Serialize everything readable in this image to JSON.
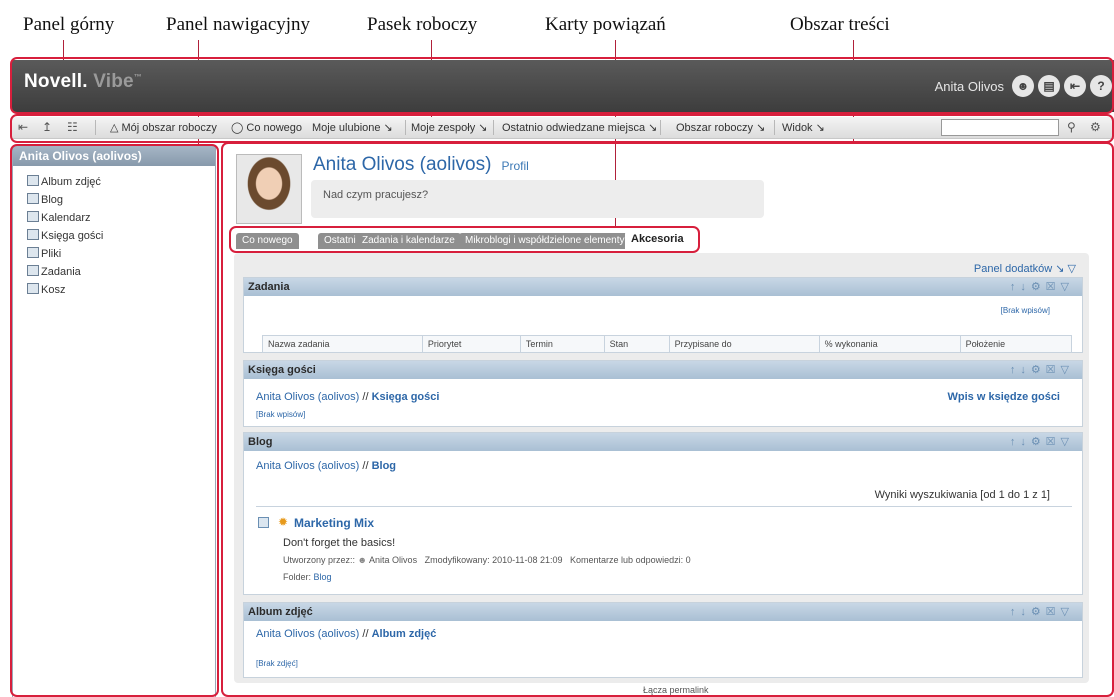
{
  "callouts": {
    "top_panel": "Panel górny",
    "nav_panel": "Panel nawigacyjny",
    "workspace_bar": "Pasek roboczy",
    "tabs": "Karty powiązań",
    "content_area": "Obszar treści"
  },
  "header": {
    "logo_main": "Novell.",
    "logo_vibe": "Vibe",
    "logo_tm": "™",
    "user": "Anita Olivos",
    "icons": [
      "person-icon",
      "notes-icon",
      "logout-icon",
      "help-icon"
    ]
  },
  "toolbar": {
    "my_workspace": "Mój obszar roboczy",
    "whats_new": "Co nowego",
    "favorites": "Moje ulubione",
    "teams": "Moje zespoły",
    "recent": "Ostatnio odwiedzane miejsca",
    "workspace": "Obszar roboczy",
    "view": "Widok",
    "search_value": ""
  },
  "sidebar": {
    "title": "Anita Olivos (aolivos)",
    "items": [
      {
        "label": "Album zdjęć",
        "icon": "photo-album-icon"
      },
      {
        "label": "Blog",
        "icon": "blog-icon"
      },
      {
        "label": "Kalendarz",
        "icon": "calendar-icon"
      },
      {
        "label": "Księga gości",
        "icon": "guestbook-icon"
      },
      {
        "label": "Pliki",
        "icon": "files-icon"
      },
      {
        "label": "Zadania",
        "icon": "tasks-icon"
      },
      {
        "label": "Kosz",
        "icon": "trash-icon"
      }
    ]
  },
  "profile": {
    "name": "Anita Olivos (aolivos)",
    "profile_link": "Profil",
    "status_placeholder": "Nad czym pracujesz?"
  },
  "tabs": [
    "Co nowego",
    "Ostatnie",
    "Zadania i kalendarze",
    "Mikroblogi i współdzielone elementy",
    "Akcesoria"
  ],
  "active_tab": "Akcesoria",
  "addons_label": "Panel dodatków",
  "panels": {
    "tasks": {
      "title": "Zadania",
      "no_entries": "[Brak wpisów]",
      "columns": [
        "Nazwa zadania",
        "Priorytet",
        "Termin",
        "Stan",
        "Przypisane do",
        "% wykonania",
        "Położenie"
      ]
    },
    "guestbook": {
      "title": "Księga gości",
      "path_user": "Anita Olivos (aolivos)",
      "path_sep": " // ",
      "path_item": "Księga gości",
      "action": "Wpis w księdze gości",
      "no_entries": "[Brak wpisów]"
    },
    "blog": {
      "title": "Blog",
      "path_user": "Anita Olivos (aolivos)",
      "path_sep": " // ",
      "path_item": "Blog",
      "results": "Wyniki wyszukiwania [od 1 do 1 z 1]",
      "entry_title": "Marketing Mix",
      "entry_text": "Don't forget the basics!",
      "created_label": "Utworzony przez::",
      "author": "Anita Olivos",
      "modified": "Zmodyfikowany: 2010-11-08 21:09",
      "comments": "Komentarze lub odpowiedzi: 0",
      "folder_label": "Folder:",
      "folder": "Blog"
    },
    "album": {
      "title": "Album zdjęć",
      "path_user": "Anita Olivos (aolivos)",
      "path_sep": " // ",
      "path_item": "Album zdjęć",
      "no_photos": "[Brak zdjęć]"
    }
  },
  "permalink": "Łącza permalink",
  "colors": {
    "frame": "#d71f3c",
    "header_bg": "#4a4a4a",
    "link": "#2d67a8",
    "panel_head": "#b9cbdd"
  }
}
